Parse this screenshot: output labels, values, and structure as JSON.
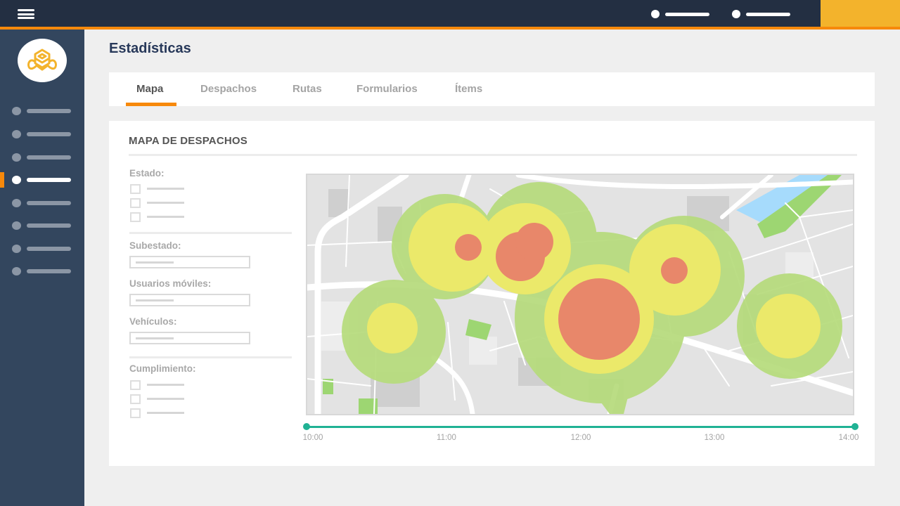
{
  "topbar": {
    "menu_icon": "hamburger-icon",
    "items": [
      {
        "icon": "dot-icon",
        "label_placeholder": ""
      },
      {
        "icon": "dot-icon",
        "label_placeholder": ""
      }
    ],
    "colors": {
      "background": "#232f42",
      "stripe": "#f7890b",
      "accent": "#f3b32c"
    }
  },
  "sidebar": {
    "logo_icon": "bee-logo-icon",
    "items": [
      {
        "active": false
      },
      {
        "active": false
      },
      {
        "active": false
      },
      {
        "active": true
      },
      {
        "active": false
      },
      {
        "active": false
      },
      {
        "active": false
      },
      {
        "active": false
      }
    ],
    "colors": {
      "background": "#33465e",
      "active_marker": "#f7890b"
    }
  },
  "page": {
    "title": "Estadísticas"
  },
  "tabs": [
    {
      "label": "Mapa",
      "active": true
    },
    {
      "label": "Despachos",
      "active": false
    },
    {
      "label": "Rutas",
      "active": false
    },
    {
      "label": "Formularios",
      "active": false
    },
    {
      "label": "Ítems",
      "active": false
    }
  ],
  "card": {
    "title": "MAPA DE DESPACHOS",
    "filters": {
      "estado_label": "Estado:",
      "estado_options": 3,
      "subestado_label": "Subestado:",
      "usuarios_label": "Usuarios móviles:",
      "vehiculos_label": "Vehículos:",
      "cumplimiento_label": "Cumplimiento:",
      "cumplimiento_options": 3
    },
    "heatmap": {
      "legend_colors": {
        "low": "#b6db7c",
        "medium": "#ebe96a",
        "high": "#e8876a"
      },
      "water_color": "#a6dbfc",
      "park_color": "#9dd672"
    },
    "timeline": {
      "range_start": "10:00",
      "range_end": "14:00",
      "ticks": [
        "10:00",
        "11:00",
        "12:00",
        "13:00",
        "14:00"
      ],
      "selected_fraction": [
        0,
        1
      ],
      "color": "#20b294"
    }
  }
}
